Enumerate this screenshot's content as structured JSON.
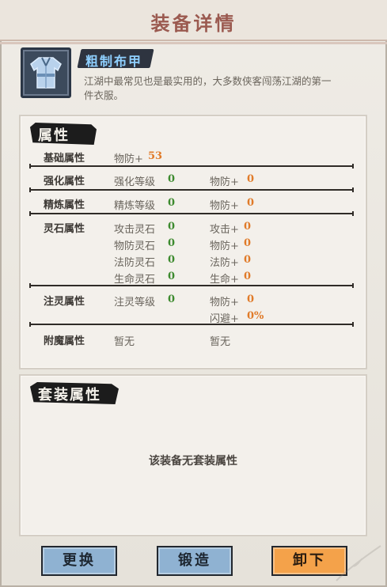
{
  "header": {
    "title": "装备详情"
  },
  "item": {
    "icon": "cloth-armor-icon",
    "name": "粗制布甲",
    "description": "江湖中最常见也是最实用的，大多数侠客闯荡江湖的第一件衣服。"
  },
  "attributes": {
    "title": "属性",
    "base": {
      "label": "基础属性",
      "stat": "物防+",
      "value": "53"
    },
    "enhance": {
      "label": "强化属性",
      "level_label": "强化等级",
      "level": "0",
      "stat": "物防+",
      "value": "0"
    },
    "refine": {
      "label": "精炼属性",
      "level_label": "精炼等级",
      "level": "0",
      "stat": "物防+",
      "value": "0"
    },
    "spirit_stone": {
      "label": "灵石属性",
      "rows": [
        {
          "stone": "攻击灵石",
          "count": "0",
          "stat": "攻击+",
          "value": "0"
        },
        {
          "stone": "物防灵石",
          "count": "0",
          "stat": "物防+",
          "value": "0"
        },
        {
          "stone": "法防灵石",
          "count": "0",
          "stat": "法防+",
          "value": "0"
        },
        {
          "stone": "生命灵石",
          "count": "0",
          "stat": "生命+",
          "value": "0"
        }
      ]
    },
    "infuse": {
      "label": "注灵属性",
      "level_label": "注灵等级",
      "level": "0",
      "stat": "物防+",
      "value": "0",
      "stat2": "闪避+",
      "value2": "0%"
    },
    "enchant": {
      "label": "附魔属性",
      "left": "暂无",
      "right": "暂无"
    }
  },
  "set_bonus": {
    "title": "套装属性",
    "empty_text": "该装备无套装属性"
  },
  "buttons": {
    "replace": "更换",
    "forge": "锻造",
    "unequip": "卸下"
  },
  "colors": {
    "accent_orange": "#f4a24a",
    "button_blue": "#8fb2d2",
    "title_red": "#9b5a50"
  }
}
